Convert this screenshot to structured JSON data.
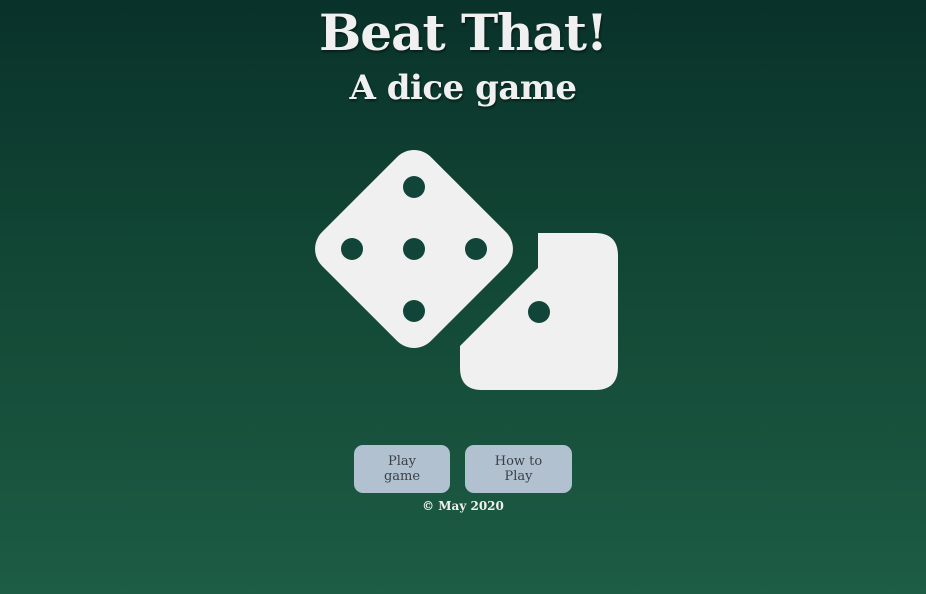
{
  "header": {
    "title": "Beat That!",
    "subtitle": "A dice game"
  },
  "hero": {
    "icon": "dice-icon",
    "dice_faces": [
      5,
      1
    ],
    "color": "#f0f0f0"
  },
  "actions": {
    "play_label": "Play game",
    "how_to_label": "How to Play",
    "button_color": "#b2c1d0"
  },
  "footer": {
    "text": "© May 2020"
  },
  "theme": {
    "background_top": "#09322a",
    "background_bottom": "#1d5c45",
    "text_color": "#f0f0f0"
  }
}
